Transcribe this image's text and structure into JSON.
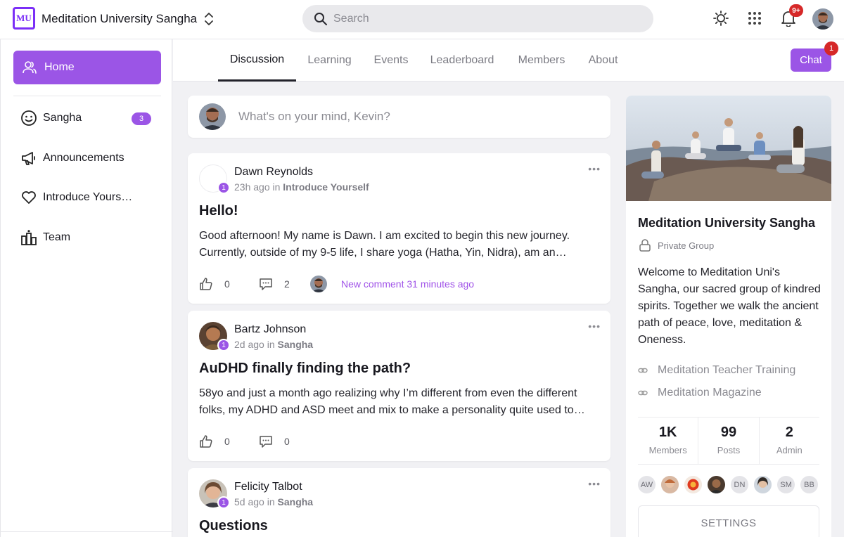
{
  "topbar": {
    "logo_text": "MU",
    "app_title": "Meditation University Sangha",
    "search_placeholder": "Search",
    "notification_count": "9+"
  },
  "sidebar": {
    "items": [
      {
        "label": "Home",
        "icon": "user-icon",
        "active": true
      },
      {
        "label": "Sangha",
        "icon": "smiley-icon",
        "badge": "3"
      },
      {
        "label": "Announcements",
        "icon": "megaphone-icon"
      },
      {
        "label": "Introduce Yours…",
        "icon": "heart-icon"
      },
      {
        "label": "Team",
        "icon": "team-icon"
      }
    ]
  },
  "tabs": [
    "Discussion",
    "Learning",
    "Events",
    "Leaderboard",
    "Members",
    "About"
  ],
  "chat": {
    "label": "Chat",
    "badge": "1"
  },
  "composer": {
    "placeholder": "What's on your mind, Kevin?"
  },
  "posts": [
    {
      "author": "Dawn Reynolds",
      "level": "1",
      "time": "23h ago",
      "in_word": "in",
      "category": "Introduce Yourself",
      "title": "Hello!",
      "body": "Good afternoon! My name is Dawn. I am excited to begin this new journey. Currently, outside of my 9-5 life, I share yoga (Hatha, Yin, Nidra), am an…",
      "likes": "0",
      "comments": "2",
      "new_comment": "New comment 31 minutes ago"
    },
    {
      "author": "Bartz Johnson",
      "level": "1",
      "time": "2d ago",
      "in_word": "in",
      "category": "Sangha",
      "title": "AuDHD finally finding the path?",
      "body": "58yo and just a month ago realizing why I’m different from even the different folks, my ADHD and ASD meet and mix to make a personality quite used to…",
      "likes": "0",
      "comments": "0"
    },
    {
      "author": "Felicity Talbot",
      "level": "1",
      "time": "5d ago",
      "in_word": "in",
      "category": "Sangha",
      "title": "Questions"
    }
  ],
  "group": {
    "name": "Meditation University Sangha",
    "privacy": "Private Group",
    "about": "Welcome to Meditation Uni's Sangha, our sacred group of kindred spirits. Together we walk the ancient path of peace, love, meditation & Oneness.",
    "links": [
      "Meditation Teacher Training",
      "Meditation Magazine"
    ],
    "stats": [
      {
        "value": "1K",
        "label": "Members"
      },
      {
        "value": "99",
        "label": "Posts"
      },
      {
        "value": "2",
        "label": "Admin"
      }
    ],
    "member_initials": [
      "AW",
      "",
      "",
      "",
      "DN",
      "",
      "SM",
      "BB"
    ],
    "settings_label": "SETTINGS"
  },
  "colors": {
    "accent": "#9b55e6",
    "badge_red": "#d62828"
  }
}
